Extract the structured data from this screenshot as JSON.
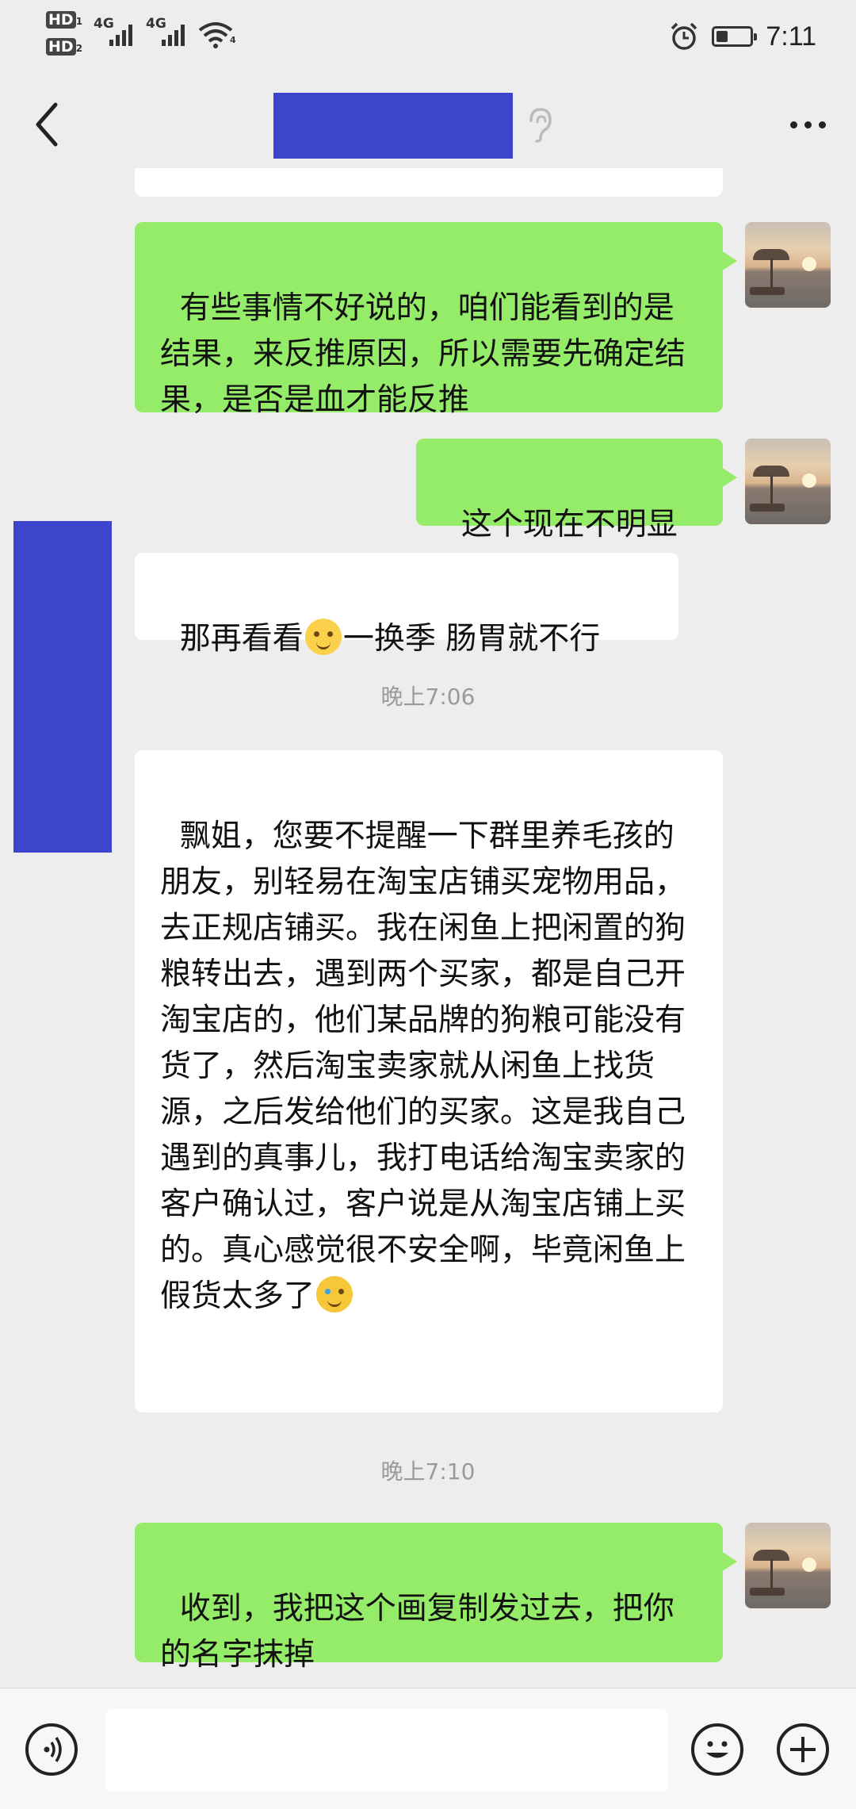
{
  "status_bar": {
    "hd1": "HD",
    "hd1_sub": "1",
    "hd2": "HD",
    "hd2_sub": "2",
    "net1": "4G",
    "net2": "4G",
    "wifi_tag": "4",
    "time": "7:11",
    "battery_level": 0.35,
    "icons": [
      "alarm-icon",
      "battery-icon",
      "wifi-icon",
      "signal-icon"
    ]
  },
  "header": {
    "back_icon": "chevron-left-icon",
    "title_redacted": true,
    "ear_icon": "ear-icon",
    "more_icon": "more-dots-icon"
  },
  "messages": [
    {
      "side": "out",
      "text": "有些事情不好说的，咱们能看到的是结果，来反推原因，所以需要先确定结果，是否是血才能反推"
    },
    {
      "side": "out",
      "text": "这个现在不明显"
    },
    {
      "side": "in",
      "text_before": "那再看看",
      "emoji": "blush-emoji",
      "text_after": "一换季 肠胃就不行"
    },
    {
      "type": "time",
      "text": "晚上7:06"
    },
    {
      "side": "in",
      "text_before": "飘姐，您要不提醒一下群里养毛孩的朋友，别轻易在淘宝店铺买宠物用品，去正规店铺买。我在闲鱼上把闲置的狗粮转出去，遇到两个买家，都是自己开淘宝店的，他们某品牌的狗粮可能没有货了，然后淘宝卖家就从闲鱼上找货源，之后发给他们的买家。这是我自己遇到的真事儿，我打电话给淘宝卖家的客户确认过，客户说是从淘宝店铺上买的。真心感觉很不安全啊，毕竟闲鱼上假货太多了",
      "emoji": "crying-laughing-emoji"
    },
    {
      "type": "time",
      "text": "晚上7:10"
    },
    {
      "side": "out",
      "text": "收到，我把这个画复制发过去，把你的名字抹掉"
    }
  ],
  "input_bar": {
    "voice_icon": "voice-icon",
    "placeholder": "",
    "emoji_icon": "smile-icon",
    "plus_icon": "plus-icon"
  },
  "colors": {
    "background": "#ededed",
    "outgoing_bubble": "#95ec69",
    "incoming_bubble": "#ffffff",
    "redaction": "#3c45cc",
    "timestamp": "#9a9a9a"
  }
}
